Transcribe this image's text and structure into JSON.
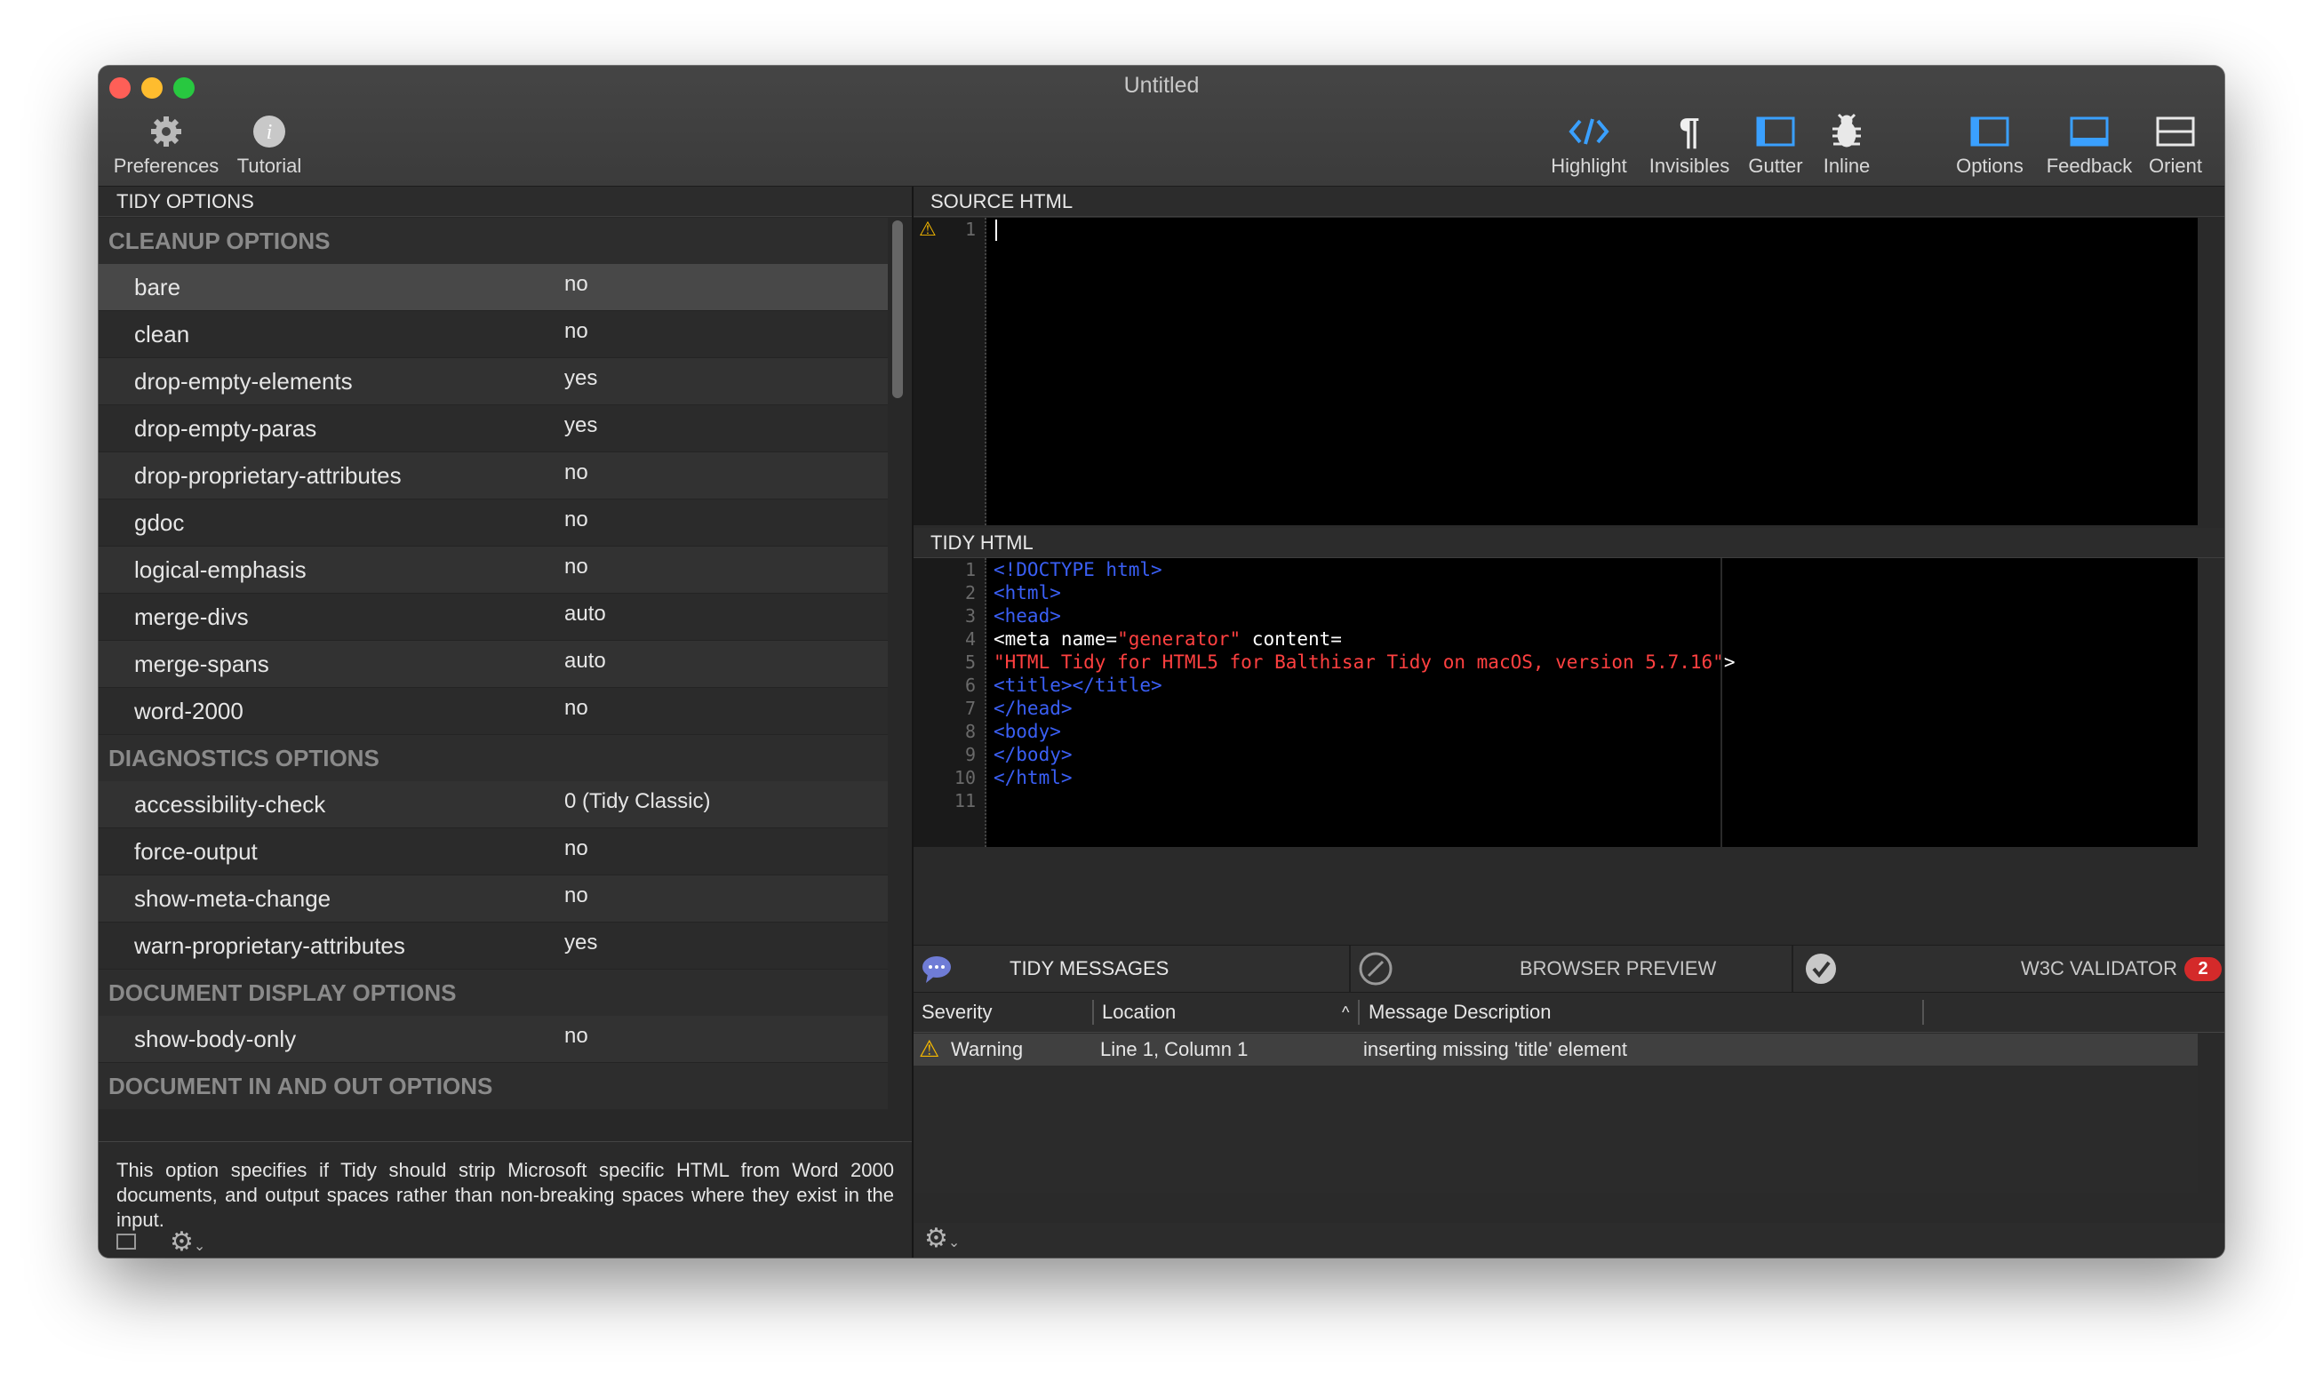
{
  "window": {
    "title": "Untitled"
  },
  "toolbar": {
    "preferences": "Preferences",
    "tutorial": "Tutorial",
    "highlight": "Highlight",
    "invisibles": "Invisibles",
    "gutter": "Gutter",
    "inline": "Inline",
    "options": "Options",
    "feedback": "Feedback",
    "orient": "Orient"
  },
  "tidy_options": {
    "header": "TIDY OPTIONS",
    "sections": [
      {
        "title": "CLEANUP OPTIONS",
        "rows": [
          {
            "k": "bare",
            "v": "no"
          },
          {
            "k": "clean",
            "v": "no"
          },
          {
            "k": "drop-empty-elements",
            "v": "yes"
          },
          {
            "k": "drop-empty-paras",
            "v": "yes"
          },
          {
            "k": "drop-proprietary-attributes",
            "v": "no"
          },
          {
            "k": "gdoc",
            "v": "no"
          },
          {
            "k": "logical-emphasis",
            "v": "no"
          },
          {
            "k": "merge-divs",
            "v": "auto"
          },
          {
            "k": "merge-spans",
            "v": "auto"
          },
          {
            "k": "word-2000",
            "v": "no"
          }
        ]
      },
      {
        "title": "DIAGNOSTICS OPTIONS",
        "rows": [
          {
            "k": "accessibility-check",
            "v": "0 (Tidy Classic)"
          },
          {
            "k": "force-output",
            "v": "no"
          },
          {
            "k": "show-meta-change",
            "v": "no"
          },
          {
            "k": "warn-proprietary-attributes",
            "v": "yes"
          }
        ]
      },
      {
        "title": "DOCUMENT DISPLAY OPTIONS",
        "rows": [
          {
            "k": "show-body-only",
            "v": "no"
          }
        ]
      },
      {
        "title": "DOCUMENT IN AND OUT OPTIONS",
        "rows": []
      }
    ],
    "description": "This option specifies if Tidy should strip Microsoft specific HTML from Word 2000 documents, and output spaces rather than non-breaking spaces where they exist in the input."
  },
  "source": {
    "header": "SOURCE HTML",
    "line_numbers": [
      "1"
    ]
  },
  "tidy": {
    "header": "TIDY HTML",
    "line_numbers": [
      "1",
      "2",
      "3",
      "4",
      "5",
      "6",
      "7",
      "8",
      "9",
      "10",
      "11"
    ],
    "lines": [
      "<!DOCTYPE html>",
      "<html>",
      "<head>",
      "<meta name=\"generator\" content=",
      "\"HTML Tidy for HTML5 for Balthisar Tidy on macOS, version 5.7.16\">",
      "<title></title>",
      "</head>",
      "<body>",
      "</body>",
      "</html>",
      ""
    ]
  },
  "tabs": {
    "messages": "TIDY MESSAGES",
    "preview": "BROWSER PREVIEW",
    "validator": "W3C VALIDATOR",
    "validator_badge": "2"
  },
  "messages": {
    "col_severity": "Severity",
    "col_location": "Location",
    "col_description": "Message Description",
    "rows": [
      {
        "severity": "Warning",
        "location": "Line 1, Column 1",
        "description": "inserting missing 'title' element"
      }
    ]
  },
  "colors": {
    "tag": "#3a5ff5",
    "string": "#ff4040",
    "accent": "#3aa0ff",
    "badge": "#d42a2a"
  }
}
